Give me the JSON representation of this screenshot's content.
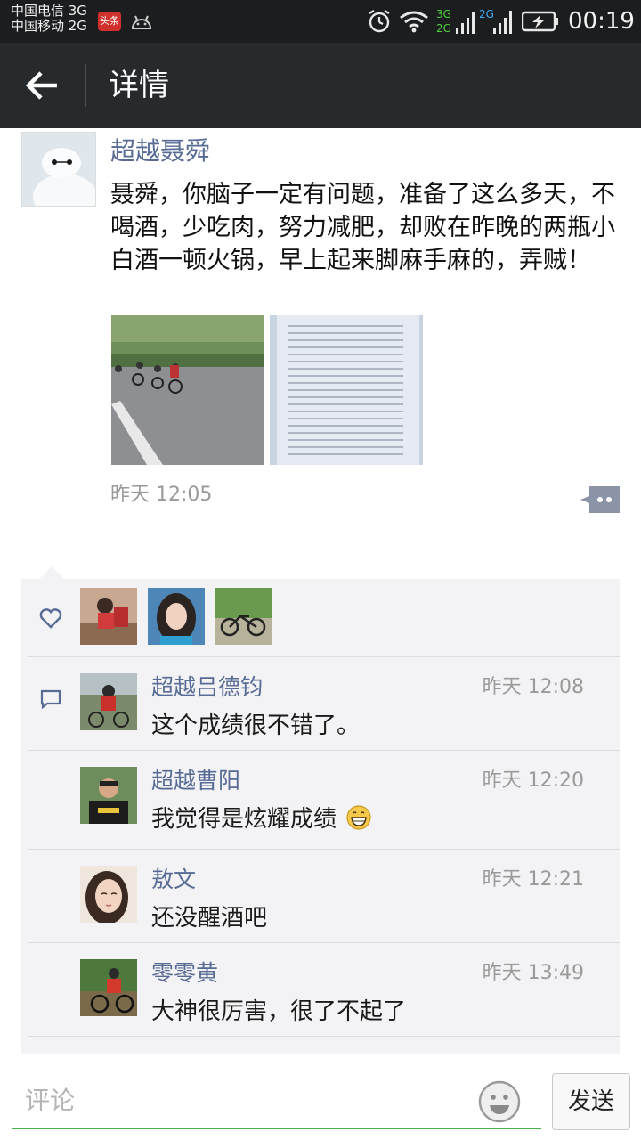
{
  "status_bar": {
    "carrier1": "中国电信 3G",
    "carrier2": "中国移动 2G",
    "app_badge": "头条",
    "net1": "3G",
    "net1b": "2G",
    "net2": "2G",
    "time": "00:19"
  },
  "title_bar": {
    "back_icon": "arrow-left-icon",
    "title": "详情"
  },
  "post": {
    "author": "超越聂舜",
    "text": "聂舜，你脑子一定有问题，准备了这么多天，不喝酒，少吃肉，努力减肥，却败在昨晚的两瓶小白酒一顿火锅，早上起来脚麻手麻的，弄贼！",
    "time": "昨天 12:05"
  },
  "likes": {
    "icon": "heart-icon",
    "count_avatars": 3
  },
  "comments": [
    {
      "name": "超越吕德钧",
      "time": "昨天 12:08",
      "text": "这个成绩很不错了。"
    },
    {
      "name": "超越曹阳",
      "time": "昨天 12:20",
      "text": "我觉得是炫耀成绩"
    },
    {
      "name": "敖文",
      "time": "昨天 12:21",
      "text": "还没醒酒吧"
    },
    {
      "name": "零零黄",
      "time": "昨天 13:49",
      "text": "大神很厉害，很了不起了"
    }
  ],
  "input_bar": {
    "placeholder": "评论",
    "send_label": "发送"
  },
  "colors": {
    "status_bg": "#1b1d1f",
    "title_bg": "#262a2c",
    "name_link": "#576b95",
    "comment_bg": "#f3f3f5",
    "input_underline": "#46b446"
  }
}
